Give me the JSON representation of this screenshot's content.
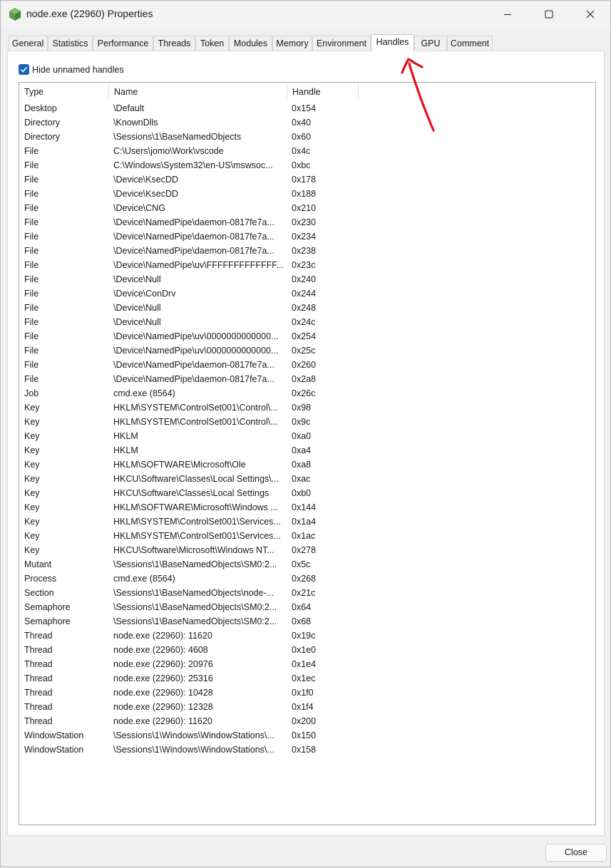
{
  "window": {
    "title": "node.exe (22960) Properties"
  },
  "tabs": [
    {
      "label": "General"
    },
    {
      "label": "Statistics"
    },
    {
      "label": "Performance"
    },
    {
      "label": "Threads"
    },
    {
      "label": "Token"
    },
    {
      "label": "Modules"
    },
    {
      "label": "Memory"
    },
    {
      "label": "Environment"
    },
    {
      "label": "Handles"
    },
    {
      "label": "GPU"
    },
    {
      "label": "Comment"
    }
  ],
  "active_tab": "Handles",
  "options": {
    "hide_unnamed_label": "Hide unnamed handles",
    "hide_unnamed_checked": true
  },
  "table": {
    "columns": [
      "Type",
      "Name",
      "Handle"
    ],
    "sorted_by": "Type",
    "rows": [
      [
        "Desktop",
        "\\Default",
        "0x154"
      ],
      [
        "Directory",
        "\\KnownDlls",
        "0x40"
      ],
      [
        "Directory",
        "\\Sessions\\1\\BaseNamedObjects",
        "0x60"
      ],
      [
        "File",
        "C:\\Users\\jomo\\Work\\vscode",
        "0x4c"
      ],
      [
        "File",
        "C:\\Windows\\System32\\en-US\\mswsoc...",
        "0xbc"
      ],
      [
        "File",
        "\\Device\\KsecDD",
        "0x178"
      ],
      [
        "File",
        "\\Device\\KsecDD",
        "0x188"
      ],
      [
        "File",
        "\\Device\\CNG",
        "0x210"
      ],
      [
        "File",
        "\\Device\\NamedPipe\\daemon-0817fe7a...",
        "0x230"
      ],
      [
        "File",
        "\\Device\\NamedPipe\\daemon-0817fe7a...",
        "0x234"
      ],
      [
        "File",
        "\\Device\\NamedPipe\\daemon-0817fe7a...",
        "0x238"
      ],
      [
        "File",
        "\\Device\\NamedPipe\\uv\\FFFFFFFFFFFFF...",
        "0x23c"
      ],
      [
        "File",
        "\\Device\\Null",
        "0x240"
      ],
      [
        "File",
        "\\Device\\ConDrv",
        "0x244"
      ],
      [
        "File",
        "\\Device\\Null",
        "0x248"
      ],
      [
        "File",
        "\\Device\\Null",
        "0x24c"
      ],
      [
        "File",
        "\\Device\\NamedPipe\\uv\\0000000000000...",
        "0x254"
      ],
      [
        "File",
        "\\Device\\NamedPipe\\uv\\0000000000000...",
        "0x25c"
      ],
      [
        "File",
        "\\Device\\NamedPipe\\daemon-0817fe7a...",
        "0x260"
      ],
      [
        "File",
        "\\Device\\NamedPipe\\daemon-0817fe7a...",
        "0x2a8"
      ],
      [
        "Job",
        "cmd.exe (8564)",
        "0x26c"
      ],
      [
        "Key",
        "HKLM\\SYSTEM\\ControlSet001\\Control\\...",
        "0x98"
      ],
      [
        "Key",
        "HKLM\\SYSTEM\\ControlSet001\\Control\\...",
        "0x9c"
      ],
      [
        "Key",
        "HKLM",
        "0xa0"
      ],
      [
        "Key",
        "HKLM",
        "0xa4"
      ],
      [
        "Key",
        "HKLM\\SOFTWARE\\Microsoft\\Ole",
        "0xa8"
      ],
      [
        "Key",
        "HKCU\\Software\\Classes\\Local Settings\\...",
        "0xac"
      ],
      [
        "Key",
        "HKCU\\Software\\Classes\\Local Settings",
        "0xb0"
      ],
      [
        "Key",
        "HKLM\\SOFTWARE\\Microsoft\\Windows ...",
        "0x144"
      ],
      [
        "Key",
        "HKLM\\SYSTEM\\ControlSet001\\Services...",
        "0x1a4"
      ],
      [
        "Key",
        "HKLM\\SYSTEM\\ControlSet001\\Services...",
        "0x1ac"
      ],
      [
        "Key",
        "HKCU\\Software\\Microsoft\\Windows NT...",
        "0x278"
      ],
      [
        "Mutant",
        "\\Sessions\\1\\BaseNamedObjects\\SM0:2...",
        "0x5c"
      ],
      [
        "Process",
        "cmd.exe (8564)",
        "0x268"
      ],
      [
        "Section",
        "\\Sessions\\1\\BaseNamedObjects\\node-...",
        "0x21c"
      ],
      [
        "Semaphore",
        "\\Sessions\\1\\BaseNamedObjects\\SM0:2...",
        "0x64"
      ],
      [
        "Semaphore",
        "\\Sessions\\1\\BaseNamedObjects\\SM0:2...",
        "0x68"
      ],
      [
        "Thread",
        "node.exe (22960): 11620",
        "0x19c"
      ],
      [
        "Thread",
        "node.exe (22960): 4608",
        "0x1e0"
      ],
      [
        "Thread",
        "node.exe (22960): 20976",
        "0x1e4"
      ],
      [
        "Thread",
        "node.exe (22960): 25316",
        "0x1ec"
      ],
      [
        "Thread",
        "node.exe (22960): 10428",
        "0x1f0"
      ],
      [
        "Thread",
        "node.exe (22960): 12328",
        "0x1f4"
      ],
      [
        "Thread",
        "node.exe (22960): 11620",
        "0x200"
      ],
      [
        "WindowStation",
        "\\Sessions\\1\\Windows\\WindowStations\\...",
        "0x150"
      ],
      [
        "WindowStation",
        "\\Sessions\\1\\Windows\\WindowStations\\...",
        "0x158"
      ]
    ]
  },
  "footer": {
    "close_label": "Close"
  },
  "colors": {
    "accent": "#1a64b8",
    "annotation": "#e0101a",
    "app_icon": "#5fa04e"
  },
  "icons": {
    "app": "node-hexagon-icon",
    "minimize": "minimize-icon",
    "maximize": "maximize-icon",
    "close": "close-icon",
    "check": "checkmark-icon",
    "sort": "sort-ascending-icon",
    "annotation": "arrow-annotation-icon"
  }
}
